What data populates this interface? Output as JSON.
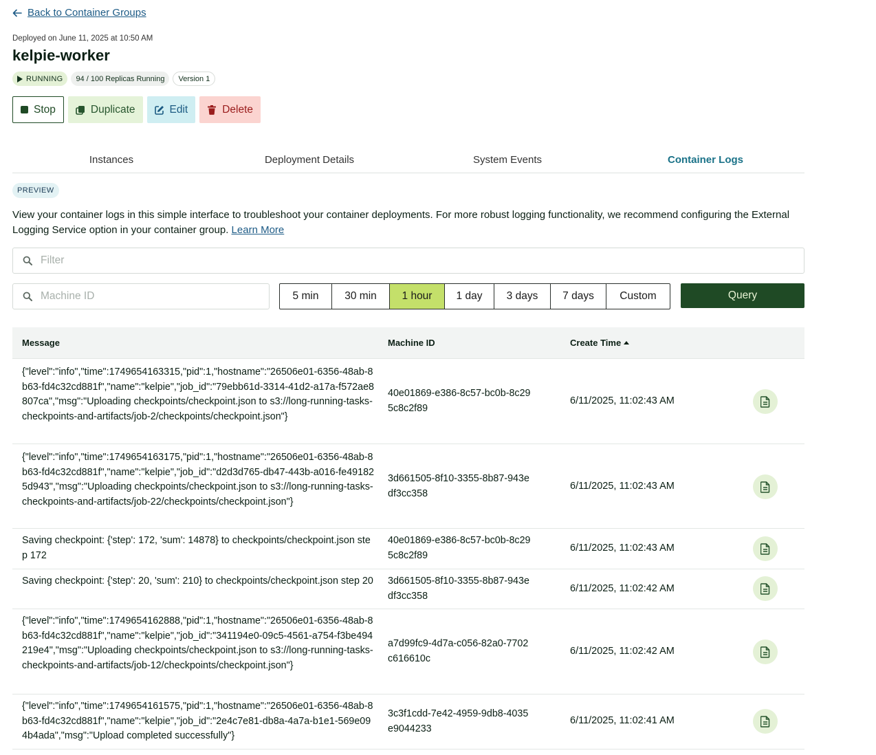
{
  "nav": {
    "back_label": "Back to Container Groups"
  },
  "header": {
    "deployed": "Deployed on June 11, 2025 at 10:50 AM",
    "title": "kelpie-worker",
    "status": "RUNNING",
    "replicas": "94 / 100 Replicas Running",
    "version": "Version 1"
  },
  "actions": {
    "stop": "Stop",
    "duplicate": "Duplicate",
    "edit": "Edit",
    "delete": "Delete"
  },
  "tabs": [
    {
      "label": "Instances",
      "active": false
    },
    {
      "label": "Deployment Details",
      "active": false
    },
    {
      "label": "System Events",
      "active": false
    },
    {
      "label": "Container Logs",
      "active": true
    }
  ],
  "logs": {
    "preview_badge": "PREVIEW",
    "description": "View your container logs in this simple interface to troubleshoot your container deployments. For more robust logging functionality, we recommend configuring the External Logging Service option in your container group.",
    "learn_more": "Learn More",
    "filter_placeholder": "Filter",
    "machine_placeholder": "Machine ID",
    "ranges": [
      "5 min",
      "30 min",
      "1 hour",
      "1 day",
      "3 days",
      "7 days",
      "Custom"
    ],
    "active_range": "1 hour",
    "query_label": "Query"
  },
  "table": {
    "columns": {
      "message": "Message",
      "machine_id": "Machine ID",
      "create_time": "Create Time"
    },
    "rows": [
      {
        "message": "{\"level\":\"info\",\"time\":1749654163315,\"pid\":1,\"hostname\":\"26506e01-6356-48ab-8b63-fd4c32cd881f\",\"name\":\"kelpie\",\"job_id\":\"79ebb61d-3314-41d2-a17a-f572ae8807ca\",\"msg\":\"Uploading checkpoints/checkpoint.json to s3://long-running-tasks-checkpoints-and-artifacts/job-2/checkpoints/checkpoint.json\"}",
        "machine_id": "40e01869-e386-8c57-bc0b-8c295c8c2f89",
        "create_time": "6/11/2025, 11:02:43 AM"
      },
      {
        "message": "{\"level\":\"info\",\"time\":1749654163175,\"pid\":1,\"hostname\":\"26506e01-6356-48ab-8b63-fd4c32cd881f\",\"name\":\"kelpie\",\"job_id\":\"d2d3d765-db47-443b-a016-fe491825d943\",\"msg\":\"Uploading checkpoints/checkpoint.json to s3://long-running-tasks-checkpoints-and-artifacts/job-22/checkpoints/checkpoint.json\"}",
        "machine_id": "3d661505-8f10-3355-8b87-943edf3cc358",
        "create_time": "6/11/2025, 11:02:43 AM"
      },
      {
        "message": "Saving checkpoint: {'step': 172, 'sum': 14878} to checkpoints/checkpoint.json step 172",
        "machine_id": "40e01869-e386-8c57-bc0b-8c295c8c2f89",
        "create_time": "6/11/2025, 11:02:43 AM"
      },
      {
        "message": "Saving checkpoint: {'step': 20, 'sum': 210} to checkpoints/checkpoint.json step 20",
        "machine_id": "3d661505-8f10-3355-8b87-943edf3cc358",
        "create_time": "6/11/2025, 11:02:42 AM"
      },
      {
        "message": "{\"level\":\"info\",\"time\":1749654162888,\"pid\":1,\"hostname\":\"26506e01-6356-48ab-8b63-fd4c32cd881f\",\"name\":\"kelpie\",\"job_id\":\"341194e0-09c5-4561-a754-f3be494219e4\",\"msg\":\"Uploading checkpoints/checkpoint.json to s3://long-running-tasks-checkpoints-and-artifacts/job-12/checkpoints/checkpoint.json\"}",
        "machine_id": "a7d99fc9-4d7a-c056-82a0-7702c616610c",
        "create_time": "6/11/2025, 11:02:42 AM"
      },
      {
        "message": "{\"level\":\"info\",\"time\":1749654161575,\"pid\":1,\"hostname\":\"26506e01-6356-48ab-8b63-fd4c32cd881f\",\"name\":\"kelpie\",\"job_id\":\"2e4c7e81-db8a-4a7a-b1e1-569e094b4ada\",\"msg\":\"Upload completed successfully\"}",
        "machine_id": "3c3f1cdd-7e42-4959-9db8-4035e9044233",
        "create_time": "6/11/2025, 11:02:41 AM"
      }
    ]
  }
}
